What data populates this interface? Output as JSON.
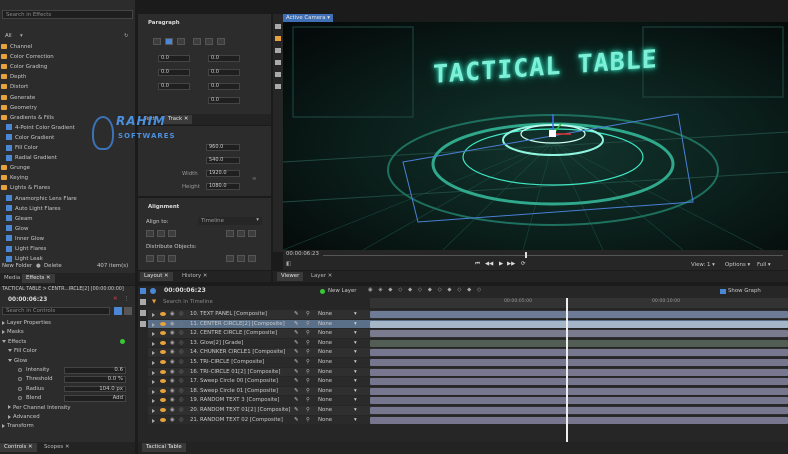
{
  "effects_panel": {
    "search_placeholder": "Search in Effects",
    "filter_value": "All",
    "items": [
      {
        "label": "Channel",
        "type": "folder",
        "indent": 0
      },
      {
        "label": "Color Correction",
        "type": "folder",
        "indent": 0
      },
      {
        "label": "Color Grading",
        "type": "folder",
        "indent": 0
      },
      {
        "label": "Depth",
        "type": "folder",
        "indent": 0
      },
      {
        "label": "Distort",
        "type": "folder",
        "indent": 0
      },
      {
        "label": "Generate",
        "type": "folder",
        "indent": 0
      },
      {
        "label": "Geometry",
        "type": "folder",
        "indent": 0
      },
      {
        "label": "Gradients & Fills",
        "type": "folder",
        "indent": 0,
        "open": true
      },
      {
        "label": "4-Point Color Gradient",
        "type": "fx",
        "indent": 1
      },
      {
        "label": "Color Gradient",
        "type": "fx",
        "indent": 1
      },
      {
        "label": "Fill Color",
        "type": "fx",
        "indent": 1
      },
      {
        "label": "Radial Gradient",
        "type": "fx",
        "indent": 1
      },
      {
        "label": "Grunge",
        "type": "folder",
        "indent": 0
      },
      {
        "label": "Keying",
        "type": "folder",
        "indent": 0
      },
      {
        "label": "Lights & Flares",
        "type": "folder",
        "indent": 0,
        "open": true
      },
      {
        "label": "Anamorphic Lens Flare",
        "type": "fx",
        "indent": 1
      },
      {
        "label": "Auto Light Flares",
        "type": "fx",
        "indent": 1
      },
      {
        "label": "Gleam",
        "type": "fx",
        "indent": 1
      },
      {
        "label": "Glow",
        "type": "fx",
        "indent": 1
      },
      {
        "label": "Inner Glow",
        "type": "fx",
        "indent": 1
      },
      {
        "label": "Light Flares",
        "type": "fx",
        "indent": 1
      },
      {
        "label": "Light Leak",
        "type": "fx",
        "indent": 1
      }
    ],
    "new_folder": "New Folder",
    "delete": "Delete",
    "count": "407 item(s)",
    "tabs": [
      "Media",
      "Effects"
    ]
  },
  "paragraph_panel": {
    "title": "Paragraph",
    "values": [
      "0.0",
      "0.0",
      "0.0",
      "0.0",
      "0.0",
      "0.0",
      "0.0"
    ],
    "tabs": [
      "Text",
      "Track"
    ]
  },
  "transform_panel": {
    "values": [
      "960.0",
      "540.0",
      "1920.0",
      "1080.0"
    ],
    "labels": [
      "Width",
      "Height"
    ]
  },
  "alignment_panel": {
    "title": "Alignment",
    "align_to_label": "Align to:",
    "align_to_value": "Timeline",
    "distribute_label": "Distribute Objects:",
    "tabs": [
      "Layout",
      "History"
    ]
  },
  "viewer": {
    "camera_tab": "Active Camera",
    "scene_text": "TACTICAL TABLE",
    "timecode": "00:00:06:23",
    "view_label": "View: 1",
    "options_label": "Options",
    "zoom_label": "Full",
    "tabs": [
      "Viewer",
      "Layer"
    ]
  },
  "controls_panel": {
    "title": "TACTICAL TABLE > CENTR...IRCLE[2] [00:00:00:00]",
    "timecode": "00:00:06:23",
    "search_placeholder": "Search in Controls",
    "sections": [
      {
        "label": "Layer Properties",
        "indent": 0
      },
      {
        "label": "Masks",
        "indent": 0
      },
      {
        "label": "Effects",
        "indent": 0
      },
      {
        "label": "Fill Color",
        "indent": 1
      },
      {
        "label": "Glow",
        "indent": 1
      }
    ],
    "params": [
      {
        "label": "Intensity",
        "value": "0.6"
      },
      {
        "label": "Threshold",
        "value": "0.0 %"
      },
      {
        "label": "Radius",
        "value": "104.0 px"
      },
      {
        "label": "Blend",
        "value": "Add"
      }
    ],
    "subsections": [
      "Per Channel Intensity",
      "Advanced",
      "Transform"
    ],
    "tabs": [
      "Controls",
      "Scopes"
    ]
  },
  "timeline": {
    "timecode": "00:00:06:23",
    "new_layer": "New Layer",
    "search_placeholder": "Search in Timeline",
    "show_graph": "Show Graph",
    "ruler_marks": [
      "00:00:05:00",
      "00:00:10:00"
    ],
    "blend_default": "None",
    "tab": "Tactical Table",
    "layers": [
      {
        "num": "10.",
        "name": "TEXT PANEL [Composite]"
      },
      {
        "num": "11.",
        "name": "CENTER CIRCLE[2] [Composite]",
        "selected": true
      },
      {
        "num": "12.",
        "name": "CENTRE CIRCLE [Composite]"
      },
      {
        "num": "13.",
        "name": "Glow[2] [Grade]"
      },
      {
        "num": "14.",
        "name": "CHUNKER CIRCLE1 [Composite]"
      },
      {
        "num": "15.",
        "name": "TRI-CIRCLE [Composite]"
      },
      {
        "num": "16.",
        "name": "TRI-CIRCLE 01[2] [Composite]"
      },
      {
        "num": "17.",
        "name": "Sweep Circle 00 [Composite]"
      },
      {
        "num": "18.",
        "name": "Sweep Circle 01 [Composite]"
      },
      {
        "num": "19.",
        "name": "RANDOM TEXT 3 [Composite]"
      },
      {
        "num": "20.",
        "name": "RANDOM TEXT 01[2] [Composite]"
      },
      {
        "num": "21.",
        "name": "RANDOM TEXT 02 [Composite]"
      }
    ]
  },
  "watermark": {
    "line1": "RAHIM",
    "line2": "SOFTWARES"
  },
  "colors": {
    "panel": "#2c2c2c",
    "accent_blue": "#4a88d6",
    "folder": "#e6a23c",
    "glow": "#3fe6c4",
    "selected": "#5a6f88"
  }
}
